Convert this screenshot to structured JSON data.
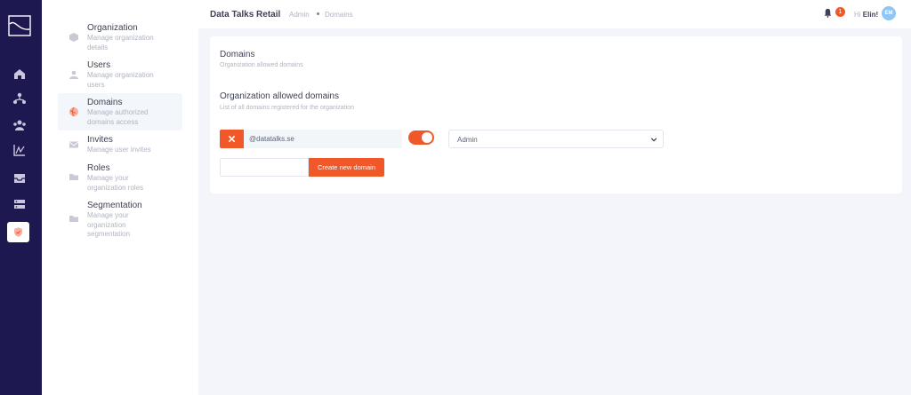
{
  "colors": {
    "rail_bg": "#1e1850",
    "accent": "#f0582a",
    "avatar_bg": "#8fc6f5"
  },
  "rail": {
    "icons": [
      "logo-icon",
      "home-icon",
      "hierarchy-icon",
      "users-group-icon",
      "chart-icon",
      "inbox-icon",
      "server-icon",
      "shield-icon"
    ]
  },
  "sidebar": {
    "items": [
      {
        "title": "Organization",
        "desc": "Manage organization details",
        "icon": "cube-icon"
      },
      {
        "title": "Users",
        "desc": "Manage organization users",
        "icon": "user-icon"
      },
      {
        "title": "Domains",
        "desc": "Manage authorized domains access",
        "icon": "globe-icon",
        "active": true
      },
      {
        "title": "Invites",
        "desc": "Manage user invites",
        "icon": "envelope-icon"
      },
      {
        "title": "Roles",
        "desc": "Manage your organization roles",
        "icon": "folder-icon"
      },
      {
        "title": "Segmentation",
        "desc": "Manage your organization segmentation",
        "icon": "folder-icon"
      }
    ]
  },
  "header": {
    "app_title": "Data Talks Retail",
    "breadcrumb": [
      "Admin",
      "Domains"
    ],
    "notification_count": "1",
    "greeting": "Hi",
    "user_name": "Elin!",
    "avatar_initials": "EM"
  },
  "main": {
    "title": "Domains",
    "subtitle": "Organization allowed domains",
    "section_title": "Organization allowed domains",
    "section_subtitle": "List of all domains registered for the organization",
    "domains": [
      {
        "value": "@datatalks.se",
        "enabled": true,
        "role": "Admin"
      }
    ],
    "new_domain_placeholder": "",
    "create_button": "Create new domain"
  }
}
